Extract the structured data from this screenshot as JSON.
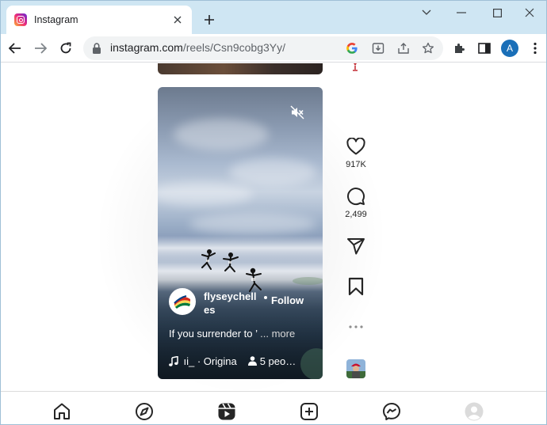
{
  "browser": {
    "tab": {
      "title": "Instagram"
    },
    "url": {
      "host": "instagram.com",
      "path": "/reels/Csn9cobg3Yy/"
    },
    "profile_initial": "A"
  },
  "reel": {
    "username_line1": "flyseychell",
    "username_line2": "es",
    "follow_label": "Follow",
    "caption": "If you surrender to ’",
    "caption_more": "... more",
    "audio": " ıi_ · Origina",
    "tagged_people": "5 peo…"
  },
  "actions": {
    "likes": "917K",
    "comments": "2,499"
  },
  "colors": {
    "titlebar": "#cfe6f3",
    "avatar": "#1a6fb8",
    "text": "#262626"
  }
}
